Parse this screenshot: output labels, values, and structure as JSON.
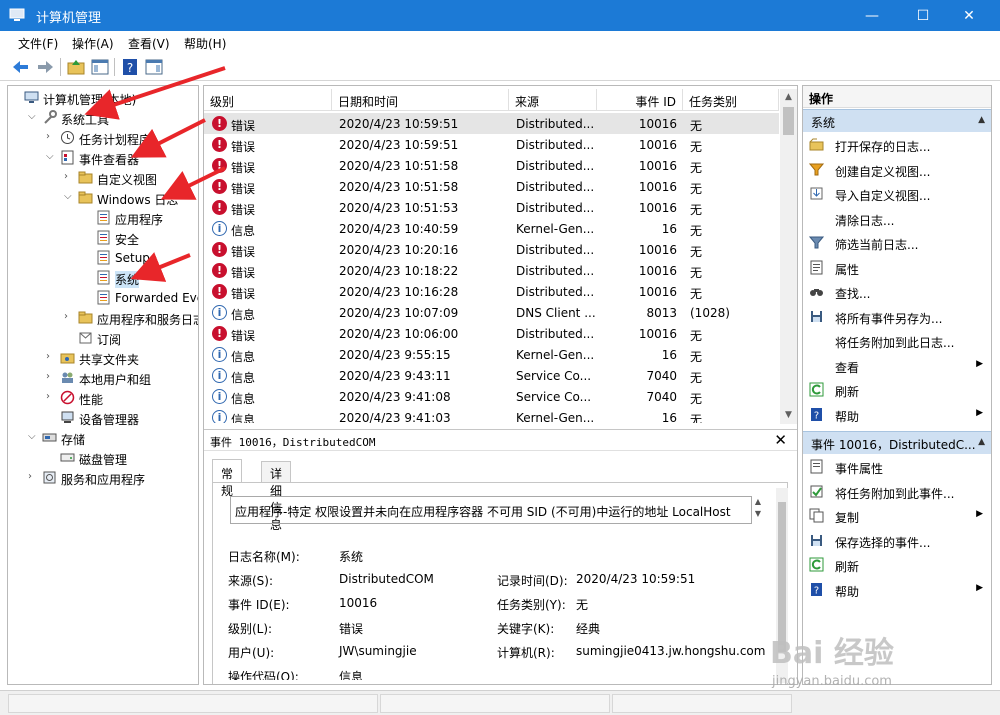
{
  "window": {
    "title": "计算机管理",
    "minimize": "—",
    "maximize": "☐",
    "close": "✕"
  },
  "menu": [
    "文件(F)",
    "操作(A)",
    "查看(V)",
    "帮助(H)"
  ],
  "tree": [
    {
      "label": "计算机管理(本地)",
      "indent": 0,
      "exp": "",
      "icon": "computer-icon"
    },
    {
      "label": "系统工具",
      "indent": 1,
      "exp": "v",
      "icon": "tools-icon"
    },
    {
      "label": "任务计划程序",
      "indent": 2,
      "exp": ">",
      "icon": "clock-icon"
    },
    {
      "label": "事件查看器",
      "indent": 2,
      "exp": "v",
      "icon": "event-viewer-icon"
    },
    {
      "label": "自定义视图",
      "indent": 3,
      "exp": ">",
      "icon": "folder-icon"
    },
    {
      "label": "Windows 日志",
      "indent": 3,
      "exp": "v",
      "icon": "folder-icon"
    },
    {
      "label": "应用程序",
      "indent": 4,
      "exp": "",
      "icon": "log-icon"
    },
    {
      "label": "安全",
      "indent": 4,
      "exp": "",
      "icon": "log-icon"
    },
    {
      "label": "Setup",
      "indent": 4,
      "exp": "",
      "icon": "log-icon"
    },
    {
      "label": "系统",
      "indent": 4,
      "exp": "",
      "icon": "log-icon",
      "selected": true
    },
    {
      "label": "Forwarded Eve",
      "indent": 4,
      "exp": "",
      "icon": "log-icon"
    },
    {
      "label": "应用程序和服务日志",
      "indent": 3,
      "exp": ">",
      "icon": "folder-icon"
    },
    {
      "label": "订阅",
      "indent": 3,
      "exp": "",
      "icon": "subscription-icon"
    },
    {
      "label": "共享文件夹",
      "indent": 2,
      "exp": ">",
      "icon": "shared-folder-icon"
    },
    {
      "label": "本地用户和组",
      "indent": 2,
      "exp": ">",
      "icon": "users-icon"
    },
    {
      "label": "性能",
      "indent": 2,
      "exp": ">",
      "icon": "performance-icon"
    },
    {
      "label": "设备管理器",
      "indent": 2,
      "exp": "",
      "icon": "device-manager-icon"
    },
    {
      "label": "存储",
      "indent": 1,
      "exp": "v",
      "icon": "storage-icon"
    },
    {
      "label": "磁盘管理",
      "indent": 2,
      "exp": "",
      "icon": "disk-icon"
    },
    {
      "label": "服务和应用程序",
      "indent": 1,
      "exp": ">",
      "icon": "services-icon"
    }
  ],
  "columns": [
    "级别",
    "日期和时间",
    "来源",
    "事件 ID",
    "任务类别"
  ],
  "events": [
    {
      "level": "错误",
      "type": "err",
      "datetime": "2020/4/23 10:59:51",
      "source": "Distributed...",
      "id": "10016",
      "category": "无",
      "selected": true
    },
    {
      "level": "错误",
      "type": "err",
      "datetime": "2020/4/23 10:59:51",
      "source": "Distributed...",
      "id": "10016",
      "category": "无"
    },
    {
      "level": "错误",
      "type": "err",
      "datetime": "2020/4/23 10:51:58",
      "source": "Distributed...",
      "id": "10016",
      "category": "无"
    },
    {
      "level": "错误",
      "type": "err",
      "datetime": "2020/4/23 10:51:58",
      "source": "Distributed...",
      "id": "10016",
      "category": "无"
    },
    {
      "level": "错误",
      "type": "err",
      "datetime": "2020/4/23 10:51:53",
      "source": "Distributed...",
      "id": "10016",
      "category": "无"
    },
    {
      "level": "信息",
      "type": "info",
      "datetime": "2020/4/23 10:40:59",
      "source": "Kernel-Gen...",
      "id": "16",
      "category": "无"
    },
    {
      "level": "错误",
      "type": "err",
      "datetime": "2020/4/23 10:20:16",
      "source": "Distributed...",
      "id": "10016",
      "category": "无"
    },
    {
      "level": "错误",
      "type": "err",
      "datetime": "2020/4/23 10:18:22",
      "source": "Distributed...",
      "id": "10016",
      "category": "无"
    },
    {
      "level": "错误",
      "type": "err",
      "datetime": "2020/4/23 10:16:28",
      "source": "Distributed...",
      "id": "10016",
      "category": "无"
    },
    {
      "level": "信息",
      "type": "info",
      "datetime": "2020/4/23 10:07:09",
      "source": "DNS Client ...",
      "id": "8013",
      "category": "(1028)"
    },
    {
      "level": "错误",
      "type": "err",
      "datetime": "2020/4/23 10:06:00",
      "source": "Distributed...",
      "id": "10016",
      "category": "无"
    },
    {
      "level": "信息",
      "type": "info",
      "datetime": "2020/4/23 9:55:15",
      "source": "Kernel-Gen...",
      "id": "16",
      "category": "无"
    },
    {
      "level": "信息",
      "type": "info",
      "datetime": "2020/4/23 9:43:11",
      "source": "Service Co...",
      "id": "7040",
      "category": "无"
    },
    {
      "level": "信息",
      "type": "info",
      "datetime": "2020/4/23 9:41:08",
      "source": "Service Co...",
      "id": "7040",
      "category": "无"
    },
    {
      "level": "信息",
      "type": "info",
      "datetime": "2020/4/23 9:41:03",
      "source": "Kernel-Gen...",
      "id": "16",
      "category": "无"
    }
  ],
  "detail": {
    "header": "事件 10016，DistributedCOM",
    "tabs": [
      "常规",
      "详细信息"
    ],
    "description": "应用程序-特定 权限设置并未向在应用程序容器 不可用 SID (不可用)中运行的地址 LocalHost",
    "fields": [
      {
        "label": "日志名称(M):",
        "value": "系统"
      },
      {
        "label": "来源(S):",
        "value": "DistributedCOM",
        "label2": "记录时间(D):",
        "value2": "2020/4/23 10:59:51"
      },
      {
        "label": "事件 ID(E):",
        "value": "10016",
        "label2": "任务类别(Y):",
        "value2": "无"
      },
      {
        "label": "级别(L):",
        "value": "错误",
        "label2": "关键字(K):",
        "value2": "经典"
      },
      {
        "label": "用户(U):",
        "value": "JW\\sumingjie",
        "label2": "计算机(R):",
        "value2": "sumingjie0413.jw.hongshu.com"
      },
      {
        "label": "操作代码(O):",
        "value": "信息"
      }
    ]
  },
  "actions": {
    "title": "操作",
    "section1": "系统",
    "items1": [
      {
        "label": "打开保存的日志...",
        "icon": "open-folder-icon"
      },
      {
        "label": "创建自定义视图...",
        "icon": "filter-create-icon"
      },
      {
        "label": "导入自定义视图...",
        "icon": "import-icon"
      },
      {
        "label": "清除日志...",
        "icon": ""
      },
      {
        "label": "筛选当前日志...",
        "icon": "filter-icon"
      },
      {
        "label": "属性",
        "icon": "properties-icon"
      },
      {
        "label": "查找...",
        "icon": "find-icon"
      },
      {
        "label": "将所有事件另存为...",
        "icon": "save-icon"
      },
      {
        "label": "将任务附加到此日志...",
        "icon": ""
      },
      {
        "label": "查看",
        "icon": "",
        "sub": true
      },
      {
        "label": "刷新",
        "icon": "refresh-icon"
      },
      {
        "label": "帮助",
        "icon": "help-icon",
        "sub": true
      }
    ],
    "section2": "事件 10016，DistributedC...",
    "items2": [
      {
        "label": "事件属性",
        "icon": "event-properties-icon"
      },
      {
        "label": "将任务附加到此事件...",
        "icon": "attach-task-icon"
      },
      {
        "label": "复制",
        "icon": "copy-icon",
        "sub": true
      },
      {
        "label": "保存选择的事件...",
        "icon": "save-icon"
      },
      {
        "label": "刷新",
        "icon": "refresh-icon"
      },
      {
        "label": "帮助",
        "icon": "help-icon",
        "sub": true
      }
    ]
  },
  "watermark": {
    "brand": "Bai 经验",
    "url": "jingyan.baidu.com"
  }
}
